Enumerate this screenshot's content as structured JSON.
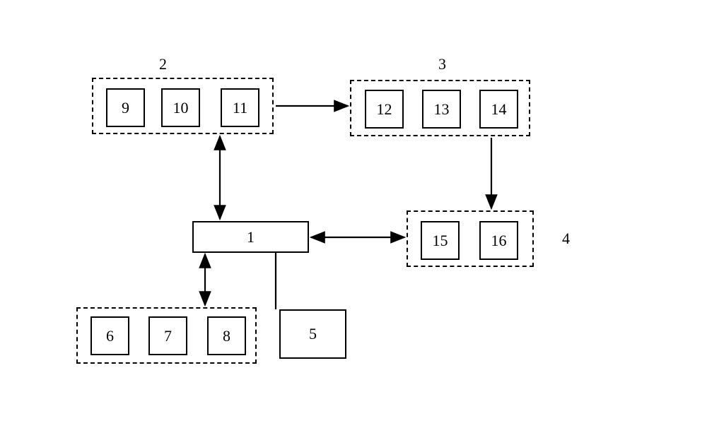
{
  "diagram": {
    "groups": {
      "group2": {
        "label": "2"
      },
      "group3": {
        "label": "3"
      },
      "group4": {
        "label": "4"
      },
      "groupLower": {
        "label": ""
      }
    },
    "nodes": {
      "n1": "1",
      "n5": "5",
      "n6": "6",
      "n7": "7",
      "n8": "8",
      "n9": "9",
      "n10": "10",
      "n11": "11",
      "n12": "12",
      "n13": "13",
      "n14": "14",
      "n15": "15",
      "n16": "16"
    }
  }
}
